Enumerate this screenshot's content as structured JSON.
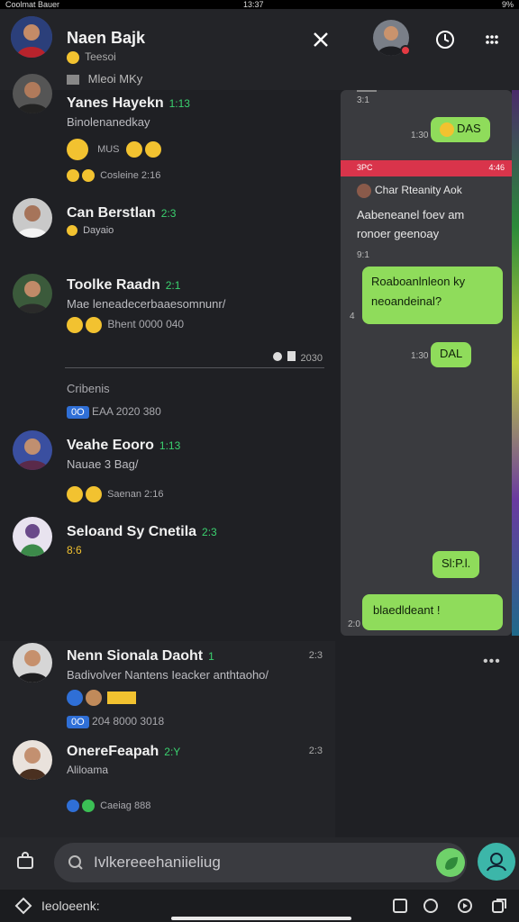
{
  "status_bar": {
    "left": "Coolmat Bauer",
    "center": "13:37",
    "right": "9%"
  },
  "header": {
    "title": "Naen Bajk",
    "subtitle": "Teesoi",
    "subtitle2": "Mleoi MKy"
  },
  "chats": [
    {
      "name": "Yanes Hayekn",
      "tag": "1:13",
      "preview": "Binolenanedkay",
      "meta": "Cosleine 2:16",
      "extra": "MUS"
    },
    {
      "name": "Can Berstlan",
      "tag": "2:3",
      "preview": "Dayaio",
      "meta": ""
    },
    {
      "name": "Toolke Raadn",
      "tag": "2:1",
      "preview": "Mae leneadecerbaaesomnunr/",
      "meta": "Bhent 0000 040"
    },
    {
      "name": "Veahe Eooro",
      "tag": "1:13",
      "preview": "Nauae 3 Bag/",
      "meta": "Saenan 2:16"
    },
    {
      "name": "Seloand Sy Cnetila",
      "tag": "2:3",
      "preview": "8:6",
      "meta": ""
    },
    {
      "name": "Nenn Sionala Daoht",
      "tag": "1",
      "preview": "Badivolver Nantens Ieacker anthtaoho/",
      "meta": "204 8000 3018",
      "time": "2:3"
    },
    {
      "name": "OnereFeapah",
      "tag": "2:Y",
      "preview": "Aliloama",
      "meta": "Caeiag 888",
      "time": "2:3"
    }
  ],
  "misc": {
    "date_row": "2030",
    "section_label": "Cribenis",
    "section_date": "EAA 2020 380",
    "badge_oo": "0O",
    "badge_blue": "0O"
  },
  "panel": {
    "t1": "3:1",
    "b1": "DAS",
    "b1_time": "1:30",
    "red_bar_left": "3PC",
    "red_bar_right": "4:46",
    "forward_name": "Char Rteanity Aok",
    "forward_text": "Aabeneanel foev am ronoer geenoay",
    "t2": "9:1",
    "b2": "Roaboanlnleon ky neoandeinal?",
    "b2_time": "4",
    "b3": "DAL",
    "b3_time": "1:30",
    "b4": "Sl:P.l.",
    "b5": "blaedldeant !",
    "b5_time": "2:0"
  },
  "composer": {
    "placeholder": "Ivlkereeehaniieliug"
  },
  "bottom_bar": {
    "label": "Ieoloeenk:"
  }
}
